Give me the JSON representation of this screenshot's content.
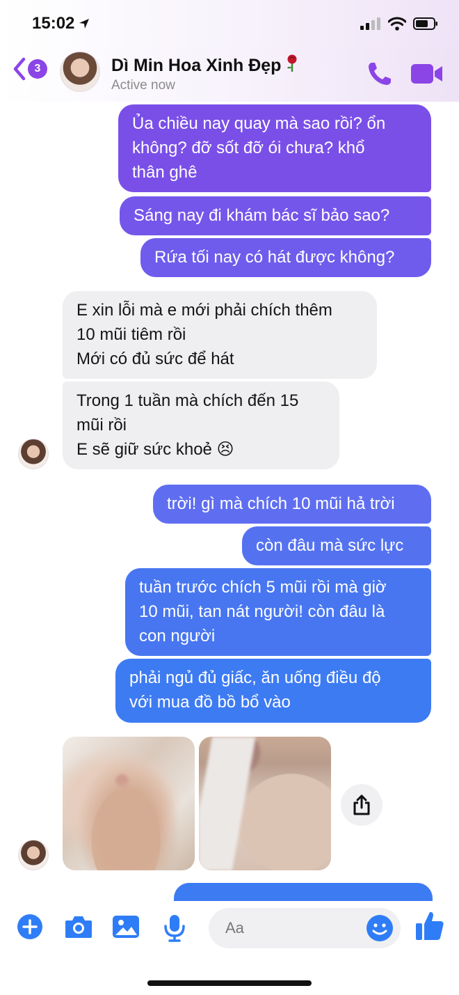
{
  "status_bar": {
    "time": "15:02"
  },
  "header": {
    "back_badge": "3",
    "contact_name": "Dì Min Hoa Xinh Đẹp",
    "contact_status": "Active now"
  },
  "messages": [
    {
      "id": "m1",
      "direction": "out",
      "lines": [
        "Ủa chiều nay quay mà sao rồi? ổn",
        "không? đỡ sốt đỡ ói chưa? khổ",
        "thân ghê"
      ]
    },
    {
      "id": "m2",
      "direction": "out",
      "lines": [
        "Sáng nay đi khám bác sĩ bảo sao?"
      ]
    },
    {
      "id": "m3",
      "direction": "out",
      "lines": [
        "Rứa tối nay có hát được không?"
      ]
    },
    {
      "id": "m4",
      "direction": "in",
      "lines": [
        "E xin lỗi mà e mới phải chích thêm",
        "10 mũi tiêm rồi",
        "Mới có đủ sức để hát"
      ]
    },
    {
      "id": "m5",
      "direction": "in",
      "lines": [
        "Trong 1 tuần mà chích đến 15",
        "mũi rồi",
        "E sẽ giữ sức khoẻ 😣"
      ]
    },
    {
      "id": "m6",
      "direction": "out",
      "lines": [
        "trời! gì mà chích 10 mũi hả trời"
      ]
    },
    {
      "id": "m7",
      "direction": "out",
      "lines": [
        "còn đâu mà sức lực"
      ]
    },
    {
      "id": "m8",
      "direction": "out",
      "lines": [
        "tuần trước chích 5 mũi rồi mà giờ",
        "10 mũi, tan nát người! còn đâu là",
        "con người"
      ]
    },
    {
      "id": "m9",
      "direction": "out",
      "lines": [
        "phải ngủ đủ giấc, ăn uống điều độ",
        "với mua đồ bồ bổ vào"
      ]
    }
  ],
  "composer": {
    "placeholder": "Aa"
  },
  "colors": {
    "accent_purple": "#8b45e6",
    "bubble_purple": "#7a4fe8",
    "bubble_blue": "#3d7bf2",
    "incoming_gray": "#efeef0"
  },
  "icons": {
    "header": [
      "back-chevron-icon",
      "phone-icon",
      "video-camera-icon"
    ],
    "composer": [
      "plus-circle-icon",
      "camera-icon",
      "image-icon",
      "microphone-icon",
      "smiley-icon",
      "thumbs-up-icon"
    ],
    "other": [
      "share-icon",
      "rose-emoji-icon"
    ]
  }
}
